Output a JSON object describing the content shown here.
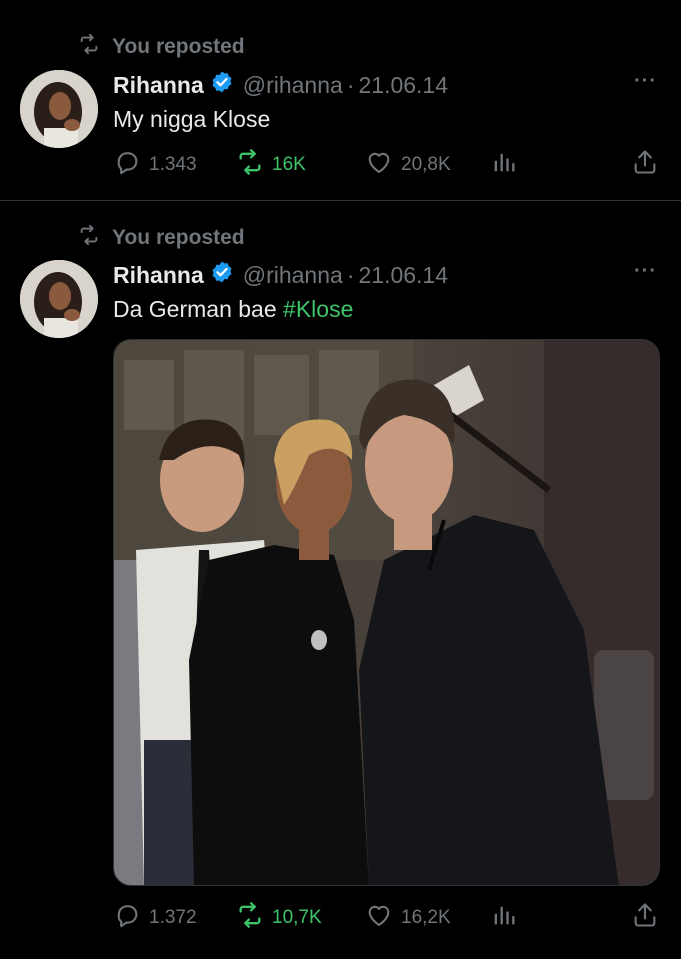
{
  "tweets": [
    {
      "repost_label": "You reposted",
      "author_name": "Rihanna",
      "handle": "@rihanna",
      "separator": "·",
      "date": "21.06.14",
      "more": "···",
      "text": "My nigga Klose",
      "stats": {
        "replies": "1.343",
        "reposts": "16K",
        "likes": "20,8K"
      }
    },
    {
      "repost_label": "You reposted",
      "author_name": "Rihanna",
      "handle": "@rihanna",
      "separator": "·",
      "date": "21.06.14",
      "more": "···",
      "text": "Da German bae",
      "hashtag": "#Klose",
      "stats": {
        "replies": "1.372",
        "reposts": "10,7K",
        "likes": "16,2K"
      }
    }
  ],
  "colors": {
    "background": "#000000",
    "text": "#e7e9ea",
    "muted": "#71767b",
    "repost_active": "#3ec36a",
    "verified": "#1d9bf0"
  },
  "icons": [
    "repost-icon",
    "verified-badge-icon",
    "more-icon",
    "reply-icon",
    "like-icon",
    "views-icon",
    "share-icon"
  ]
}
